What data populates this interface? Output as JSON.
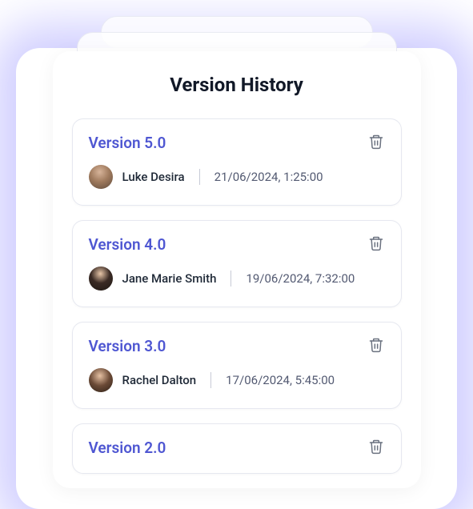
{
  "title": "Version History",
  "versions": [
    {
      "label": "Version 5.0",
      "user": "Luke Desira",
      "timestamp": "21/06/2024, 1:25:00"
    },
    {
      "label": "Version 4.0",
      "user": "Jane Marie Smith",
      "timestamp": "19/06/2024, 7:32:00"
    },
    {
      "label": "Version 3.0",
      "user": "Rachel Dalton",
      "timestamp": "17/06/2024, 5:45:00"
    },
    {
      "label": "Version 2.0",
      "user": "",
      "timestamp": ""
    }
  ]
}
